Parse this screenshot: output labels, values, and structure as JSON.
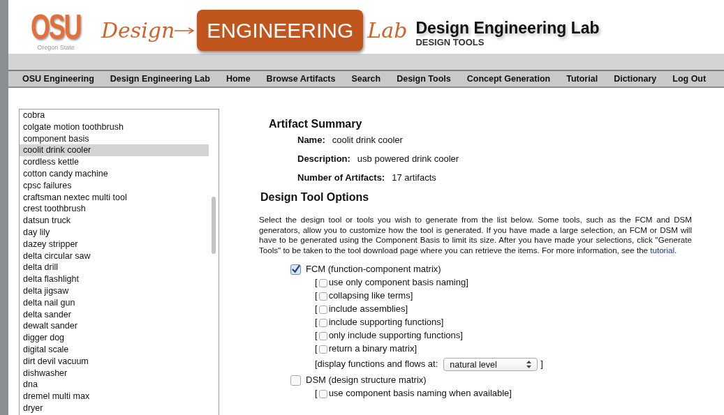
{
  "header": {
    "osu_logo": {
      "letters": "OSU",
      "subtitle": "Oregon State"
    },
    "lab_logo": {
      "left": "Design",
      "box": "ENGINEERING",
      "right": "Lab"
    },
    "title": "Design Engineering Lab",
    "subtitle": "DESIGN TOOLS"
  },
  "nav": [
    "OSU Engineering",
    "Design Engineering Lab",
    "Home",
    "Browse Artifacts",
    "Search",
    "Design Tools",
    "Concept Generation",
    "Tutorial",
    "Dictionary",
    "Log Out"
  ],
  "artifact_list": [
    {
      "label": "cobra",
      "selected": false
    },
    {
      "label": "colgate motion toothbrush",
      "selected": false
    },
    {
      "label": "component basis",
      "selected": false
    },
    {
      "label": "coolit drink cooler",
      "selected": true
    },
    {
      "label": "cordless kettle",
      "selected": false
    },
    {
      "label": "cotton candy machine",
      "selected": false
    },
    {
      "label": "cpsc failures",
      "selected": false
    },
    {
      "label": "craftsman nextec multi tool",
      "selected": false
    },
    {
      "label": "crest toothbrush",
      "selected": false
    },
    {
      "label": "datsun truck",
      "selected": false
    },
    {
      "label": "day lily",
      "selected": false
    },
    {
      "label": "dazey stripper",
      "selected": false
    },
    {
      "label": "delta circular saw",
      "selected": false
    },
    {
      "label": "delta drill",
      "selected": false
    },
    {
      "label": "delta flashlight",
      "selected": false
    },
    {
      "label": "delta jigsaw",
      "selected": false
    },
    {
      "label": "delta nail gun",
      "selected": false
    },
    {
      "label": "delta sander",
      "selected": false
    },
    {
      "label": "dewalt sander",
      "selected": false
    },
    {
      "label": "digger dog",
      "selected": false
    },
    {
      "label": "digital scale",
      "selected": false
    },
    {
      "label": "dirt devil vacuum",
      "selected": false
    },
    {
      "label": "dishwasher",
      "selected": false
    },
    {
      "label": "dna",
      "selected": false
    },
    {
      "label": "dremel multi max",
      "selected": false
    },
    {
      "label": "dryer",
      "selected": false
    }
  ],
  "summary": {
    "title": "Artifact Summary",
    "fields": [
      {
        "label": "Name:",
        "value": "coolit drink cooler"
      },
      {
        "label": "Description:",
        "value": "usb powered drink cooler"
      },
      {
        "label": "Number of Artifacts:",
        "value": "17 artifacts"
      }
    ]
  },
  "options": {
    "title": "Design Tool Options",
    "intro": "Select the design tool or tools you wish to generate from the list below. Some tools, such as the FCM and DSM generators, allow you to customize how the tool is generated. If you have made a large selection, an FCM or DSM will have to be generated using the Component Basis to limit its size. After you have made your selections, click \"Generate Tools\" to be taken to the tool download page where you can retrieve the items. For more information, see the",
    "intro_link": "tutorial",
    "intro_end": ".",
    "tools": [
      {
        "label": "FCM (function-component matrix)",
        "checked": true,
        "suboptions": [
          {
            "kind": "checkbox",
            "open": "[",
            "label": "use only component basis naming]",
            "checked": false
          },
          {
            "kind": "checkbox",
            "open": "[",
            "label": "collapsing like terms]",
            "checked": false
          },
          {
            "kind": "checkbox",
            "open": "[",
            "label": "include assemblies]",
            "checked": false
          },
          {
            "kind": "checkbox",
            "open": "[",
            "label": "include supporting functions]",
            "checked": false
          },
          {
            "kind": "checkbox",
            "open": "[",
            "label": "only include supporting functions]",
            "checked": false
          },
          {
            "kind": "checkbox",
            "open": "[",
            "label": "return a binary matrix]",
            "checked": false
          },
          {
            "kind": "select",
            "label": "[display functions and flows at:",
            "value": "natural level",
            "close": "]"
          }
        ]
      },
      {
        "label": "DSM (design structure matrix)",
        "checked": false,
        "suboptions": [
          {
            "kind": "checkbox",
            "open": "[",
            "label": "use component basis naming when available]",
            "checked": false
          }
        ]
      }
    ]
  }
}
